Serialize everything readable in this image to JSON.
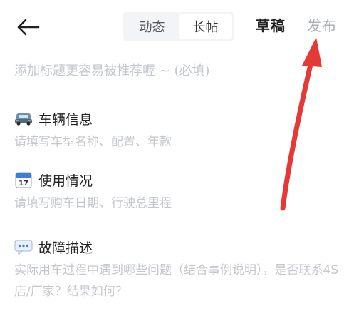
{
  "header": {
    "tabs": [
      {
        "label": "动态",
        "active": false
      },
      {
        "label": "长帖",
        "active": true
      }
    ],
    "draft_label": "草稿",
    "publish_label": "发布"
  },
  "title_input": {
    "placeholder": "添加标题更容易被推荐喔 ~ (必填)",
    "value": ""
  },
  "sections": [
    {
      "icon": "car-icon",
      "title": "车辆信息",
      "hint": "请填写车型名称、配置、年款"
    },
    {
      "icon": "calendar-icon",
      "title": "使用情况",
      "hint": "请填写购车日期、行驶总里程"
    },
    {
      "icon": "speech-bubble-icon",
      "title": "故障描述",
      "hint": "实际用车过程中遇到哪些问题（结合事例说明），是否联系4S店/厂家？结果如何？"
    }
  ],
  "colors": {
    "placeholder": "#c4c7cc",
    "publish_disabled": "#a8adb4",
    "annotation_arrow": "#e53935",
    "segment_bg": "#f3f4f6"
  }
}
